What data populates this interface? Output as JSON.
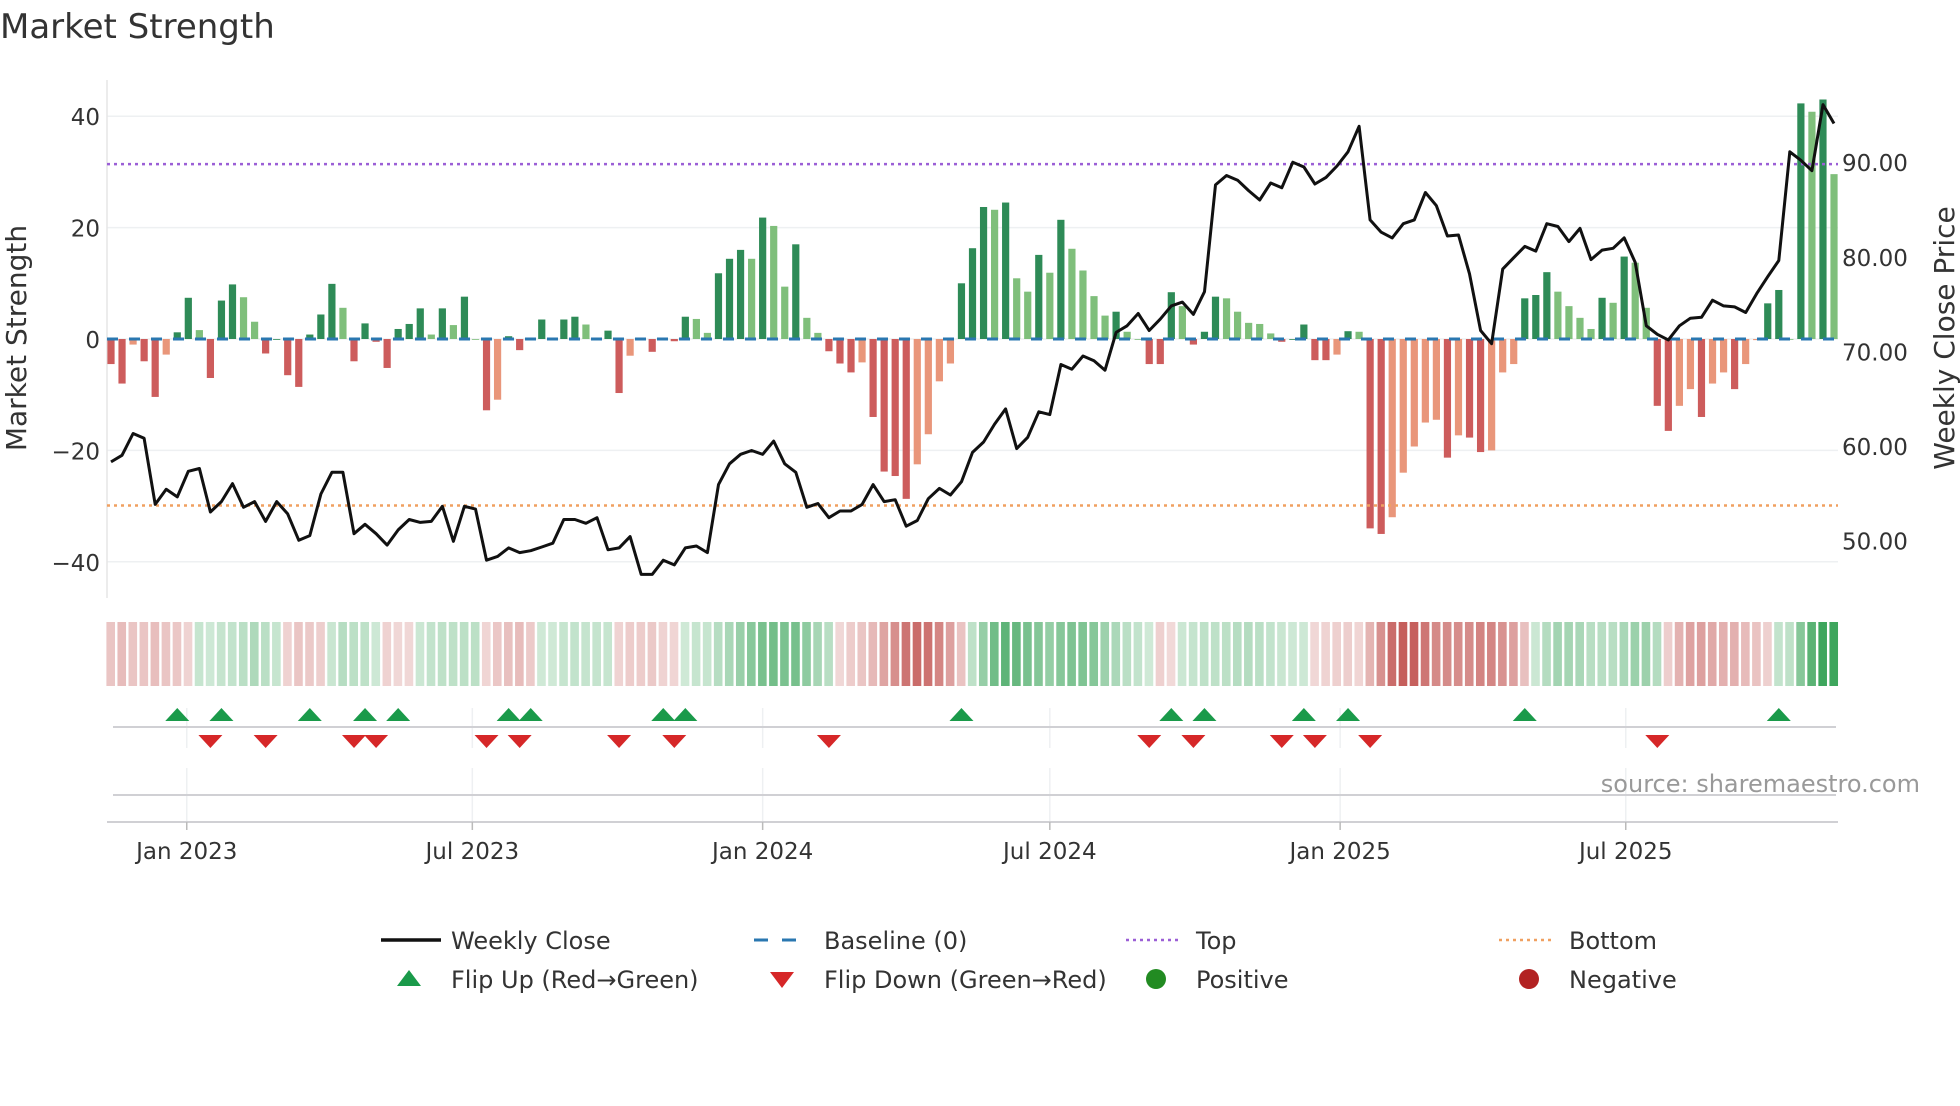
{
  "title": "Market Strength",
  "source": "source: sharemaestro.com",
  "chart_data": {
    "type": "bar",
    "title": "Market Strength",
    "ylabel": "Market Strength",
    "y2label": "Weekly Close Price",
    "ylim": [
      -46.5,
      46.5
    ],
    "y2lim": [
      43.9,
      98.7
    ],
    "yticks": [
      40,
      20,
      0,
      -20,
      -40
    ],
    "yticklabels": [
      "40",
      "20",
      "0",
      "−20",
      "−40"
    ],
    "y2ticks": [
      90,
      80,
      70,
      60,
      50
    ],
    "y2ticklabels": [
      "90.00",
      "80.00",
      "70.00",
      "60.00",
      "50.00"
    ],
    "xticks": [
      {
        "date": "2023-01-01",
        "label": "Jan 2023"
      },
      {
        "date": "2023-07-01",
        "label": "Jul 2023"
      },
      {
        "date": "2024-01-01",
        "label": "Jan 2024"
      },
      {
        "date": "2024-07-01",
        "label": "Jul 2024"
      },
      {
        "date": "2025-01-01",
        "label": "Jan 2025"
      },
      {
        "date": "2025-07-01",
        "label": "Jul 2025"
      }
    ],
    "start_date": "2022-11-14",
    "interval": "weekly",
    "top_level": 31.4,
    "bottom_level": -29.9,
    "strength": [
      -4.5,
      -8,
      -1,
      -4,
      -10.4,
      -2.8,
      1.2,
      7.4,
      1.6,
      -7,
      6.9,
      9.8,
      7.5,
      3.1,
      -2.6,
      0,
      -6.5,
      -8.6,
      0.8,
      4.4,
      9.9,
      5.6,
      -4,
      2.8,
      -0.5,
      -5.2,
      1.8,
      2.7,
      5.5,
      0.8,
      5.5,
      2.5,
      7.6,
      0,
      -12.8,
      -10.9,
      0.5,
      -2,
      0.2,
      3.5,
      0,
      3.5,
      4,
      2.6,
      0.2,
      1.5,
      -9.7,
      -3,
      0,
      -2.3,
      0,
      -0.4,
      4,
      3.6,
      1.1,
      11.8,
      14.4,
      16,
      14.4,
      21.8,
      20.3,
      9.4,
      17,
      3.8,
      1.1,
      -2.2,
      -4.4,
      -6,
      -4.2,
      -14,
      -23.8,
      -24.6,
      -28.7,
      -22.5,
      -17.1,
      -7.6,
      -4.4,
      10,
      16.3,
      23.7,
      23.2,
      24.5,
      10.9,
      8.5,
      15.1,
      11.9,
      21.4,
      16.2,
      12.3,
      7.7,
      4.2,
      4.9,
      1.3,
      0,
      -4.5,
      -4.5,
      8.4,
      5.9,
      -1,
      1.3,
      7.6,
      7.3,
      4.9,
      2.9,
      2.7,
      1,
      -0.5,
      0,
      2.6,
      -3.8,
      -3.8,
      -2.8,
      1.4,
      1.3,
      -34,
      -35,
      -32,
      -24,
      -19.3,
      -15,
      -14.5,
      -21.3,
      -17.3,
      -17.7,
      -20.3,
      -20,
      -6,
      -4.5,
      7.3,
      7.9,
      12,
      8.5,
      5.9,
      3.8,
      1.8,
      7.4,
      6.5,
      14.8,
      13.7,
      5.6,
      -12,
      -16.5,
      -12,
      -9,
      -14,
      -8,
      -6,
      -9,
      -4.5,
      -0.2,
      6.4,
      8.8,
      0,
      42.3,
      40.8,
      43,
      29.6
    ],
    "weekly_close": [
      58.3,
      59.0,
      61.3,
      60.8,
      53.8,
      55.4,
      54.6,
      57.3,
      57.6,
      53.0,
      54.1,
      56.0,
      53.5,
      54.1,
      52.0,
      54.1,
      52.8,
      50.0,
      50.5,
      54.9,
      57.2,
      57.2,
      50.7,
      51.7,
      50.7,
      49.5,
      51.1,
      52.2,
      51.9,
      52.0,
      53.6,
      49.9,
      53.6,
      53.3,
      47.9,
      48.3,
      49.2,
      48.7,
      48.9,
      49.3,
      49.7,
      52.2,
      52.2,
      51.8,
      52.4,
      49.0,
      49.2,
      50.4,
      46.4,
      46.4,
      47.9,
      47.4,
      49.2,
      49.4,
      48.7,
      55.9,
      58.1,
      59.1,
      59.5,
      59.1,
      60.5,
      58.1,
      57.2,
      53.5,
      53.9,
      52.4,
      53.1,
      53.1,
      53.8,
      55.9,
      54.1,
      54.3,
      51.5,
      52.1,
      54.4,
      55.5,
      54.8,
      56.2,
      59.3,
      60.4,
      62.3,
      63.9,
      59.7,
      60.9,
      63.6,
      63.3,
      68.6,
      68.1,
      69.5,
      69.0,
      68.0,
      72.0,
      72.7,
      74.0,
      72.2,
      73.4,
      74.8,
      75.2,
      73.9,
      76.3,
      87.6,
      88.6,
      88.1,
      87.0,
      86.0,
      87.8,
      87.3,
      90.0,
      89.5,
      87.7,
      88.4,
      89.6,
      91.1,
      93.8,
      83.9,
      82.6,
      82.0,
      83.5,
      83.9,
      86.8,
      85.4,
      82.2,
      82.3,
      78.2,
      72.2,
      70.8,
      78.7,
      79.9,
      81.1,
      80.6,
      83.5,
      83.2,
      81.6,
      83.0,
      79.7,
      80.7,
      80.9,
      82.0,
      79.4,
      72.7,
      71.8,
      71.2,
      72.7,
      73.5,
      73.6,
      75.4,
      74.8,
      74.7,
      74.1,
      76.1,
      77.9,
      79.6,
      91.1,
      90.2,
      89.1,
      96.1,
      94.1
    ],
    "flip_up_weeks": [
      6,
      10,
      18,
      23,
      26,
      36,
      38,
      50,
      52,
      77,
      96,
      99,
      108,
      112,
      128,
      151
    ],
    "flip_down_weeks": [
      9,
      14,
      22,
      24,
      34,
      37,
      46,
      51,
      65,
      94,
      98,
      106,
      109,
      114,
      140
    ],
    "legend": {
      "placement": "bottom",
      "items": [
        {
          "label": "Weekly Close",
          "kind": "line"
        },
        {
          "label": "Baseline (0)",
          "kind": "dash"
        },
        {
          "label": "Top",
          "kind": "dot-purple"
        },
        {
          "label": "Bottom",
          "kind": "dot-orange"
        },
        {
          "label": "Flip Up (Red→Green)",
          "kind": "tri-up"
        },
        {
          "label": "Flip Down (Green→Red)",
          "kind": "tri-down"
        },
        {
          "label": "Positive",
          "kind": "circle-green"
        },
        {
          "label": "Negative",
          "kind": "circle-red"
        }
      ]
    },
    "colors": {
      "pos_up": "#2e8b57",
      "pos_down": "#7fbf7b",
      "neg_down": "#cd5c5c",
      "neg_up": "#e9967a",
      "baseline": "#2a77b0",
      "top": "#9b5fd6",
      "bottom": "#f0a060",
      "close": "#111111",
      "flip_up": "#1a9a4a",
      "flip_down": "#d62728",
      "positive": "#228b22",
      "negative": "#b22222",
      "strip_green": "#2e9e4f",
      "strip_red": "#c0504d"
    }
  }
}
